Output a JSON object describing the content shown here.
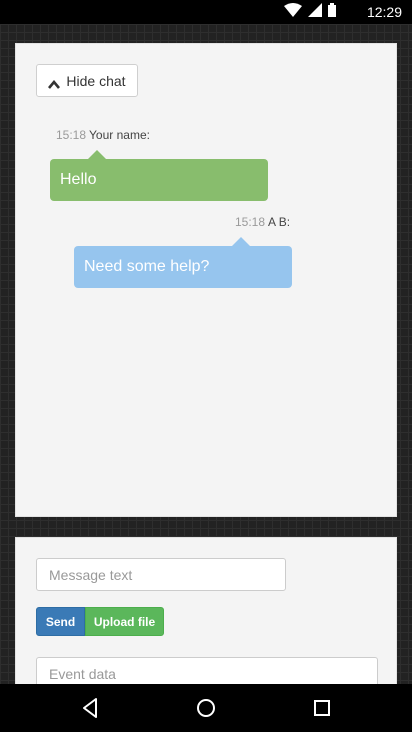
{
  "status_bar": {
    "time": "12:29",
    "icons": [
      "wifi-icon",
      "signal-icon",
      "battery-icon"
    ]
  },
  "chat": {
    "hide_button_label": "Hide chat",
    "messages": [
      {
        "time": "15:18",
        "sender": "Your name:",
        "text": "Hello",
        "color": "#88bd6d"
      },
      {
        "time": "15:18",
        "sender": "A B:",
        "text": "Need some help?",
        "color": "#96c5ee"
      }
    ]
  },
  "composer": {
    "message_placeholder": "Message text",
    "send_label": "Send",
    "upload_label": "Upload file",
    "event_placeholder": "Event data"
  },
  "nav_bar": {
    "icons": [
      "back-icon",
      "home-icon",
      "recents-icon"
    ]
  },
  "colors": {
    "send": "#3a7ab6",
    "upload": "#5bb75b"
  }
}
